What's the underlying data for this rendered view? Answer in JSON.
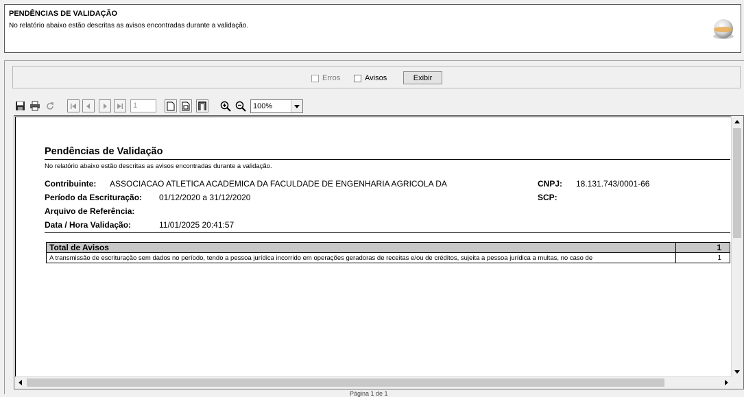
{
  "header": {
    "title": "PENDÊNCIAS DE VALIDAÇÃO",
    "description": "No relatório abaixo estão descritas as avisos encontradas durante a validação."
  },
  "filters": {
    "erros_label": "Erros",
    "avisos_label": "Avisos",
    "exibir_label": "Exibir"
  },
  "toolbar": {
    "page_number": "1",
    "zoom": "100%"
  },
  "report": {
    "title": "Pendências de Validação",
    "description": "No relatório abaixo estão descritas as avisos encontradas durante a validação.",
    "contribuinte_label": "Contribuinte:",
    "contribuinte_value": "ASSOCIACAO ATLETICA ACADEMICA DA FACULDADE DE ENGENHARIA AGRICOLA DA",
    "cnpj_label": "CNPJ:",
    "cnpj_value": "18.131.743/0001-66",
    "periodo_label": "Período da Escrituração:",
    "periodo_value": "01/12/2020 a 31/12/2020",
    "scp_label": "SCP:",
    "arquivo_label": "Arquivo de Referência:",
    "datahora_label": "Data / Hora Validação:",
    "datahora_value": "11/01/2025 20:41:57",
    "table": {
      "header_label": "Total de Avisos",
      "header_count": "1",
      "rows": [
        {
          "text": "A transmissão de escrituração sem dados no período, tendo a pessoa jurídica incorrido em operações geradoras de receitas e/ou de créditos, sujeita a pessoa jurídica a multas, no caso de",
          "count": "1"
        }
      ]
    }
  },
  "footer": {
    "page_text": "Página 1 de 1"
  }
}
